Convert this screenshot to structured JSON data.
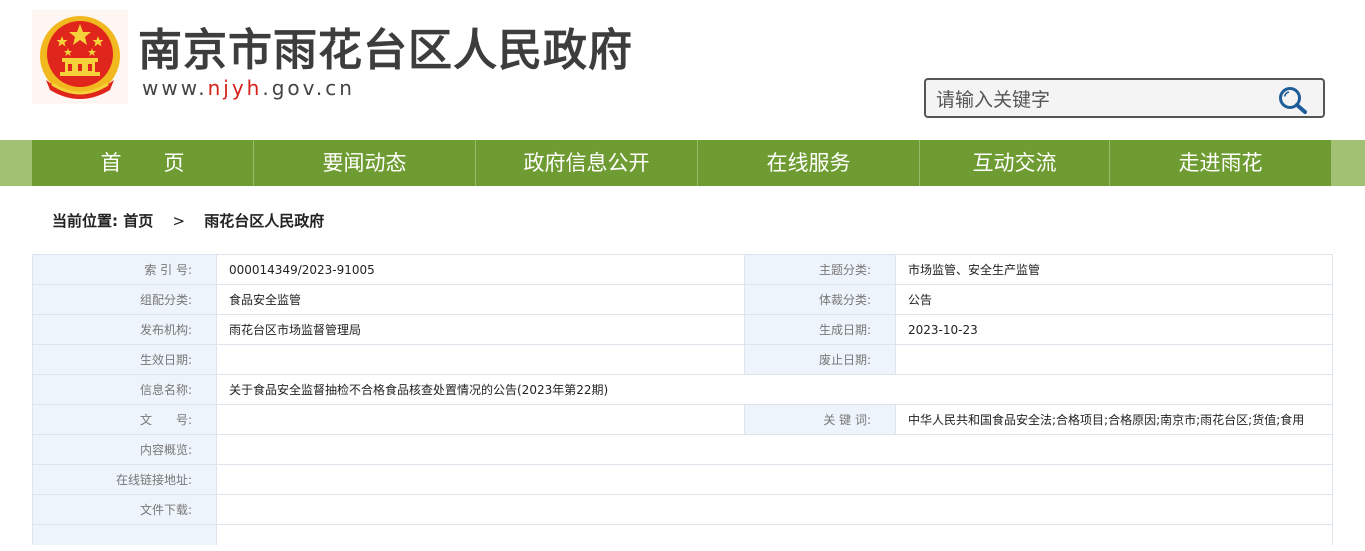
{
  "header": {
    "site_title": "南京市雨花台区人民政府",
    "url_prefix": "www.",
    "url_highlight": "njyh",
    "url_suffix": ".gov.cn",
    "emblem_icon": "national-emblem-icon",
    "search": {
      "placeholder": "请输入关键字",
      "icon": "search-icon"
    }
  },
  "nav": {
    "items": [
      "首　　页",
      "要闻动态",
      "政府信息公开",
      "在线服务",
      "互动交流",
      "走进雨花"
    ]
  },
  "breadcrumb": {
    "label": "当前位置:",
    "home": "首页",
    "separator": ">",
    "current": "雨花台区人民政府"
  },
  "info": {
    "index_label": "索 引 号:",
    "index_value": "000014349/2023-91005",
    "topic_label": "主题分类:",
    "topic_value": "市场监管、安全生产监管",
    "group_label": "组配分类:",
    "group_value": "食品安全监管",
    "genre_label": "体裁分类:",
    "genre_value": "公告",
    "publisher_label": "发布机构:",
    "publisher_value": "雨花台区市场监督管理局",
    "created_label": "生成日期:",
    "created_value": "2023-10-23",
    "effective_label": "生效日期:",
    "effective_value": "",
    "abolish_label": "废止日期:",
    "abolish_value": "",
    "name_label": "信息名称:",
    "name_value": "关于食品安全监督抽检不合格食品核查处置情况的公告(2023年第22期)",
    "doc_no_label": "文　　号:",
    "doc_no_value": "",
    "keywords_label": "关 键 词:",
    "keywords_value": "中华人民共和国食品安全法;合格项目;合格原因;南京市;雨花台区;货值;食用",
    "overview_label": "内容概览:",
    "overview_value": "",
    "link_label": "在线链接地址:",
    "link_value": "",
    "download_label": "文件下载:",
    "download_value": ""
  },
  "colors": {
    "nav_bg": "#6f9c32",
    "nav_band": "#a2c173",
    "label_bg": "#eef4fb",
    "url_highlight": "#d6211b"
  }
}
